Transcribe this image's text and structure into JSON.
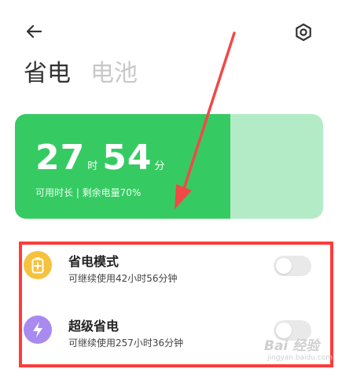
{
  "header": {
    "tabs": [
      {
        "label": "省电",
        "active": true
      },
      {
        "label": "电池",
        "active": false
      }
    ]
  },
  "battery_card": {
    "hours": "27",
    "hours_unit": "时",
    "minutes": "54",
    "minutes_unit": "分",
    "subtitle": "可用时长 | 剩余电量70%",
    "level_percent": 70,
    "fill_color": "#36cb62",
    "empty_color": "#b4ebc7"
  },
  "modes": [
    {
      "title": "省电模式",
      "description": "可继续使用42小时56分钟",
      "icon": "battery-plus-icon",
      "icon_color": "#f6c23e",
      "enabled": false
    },
    {
      "title": "超级省电",
      "description": "可继续使用257小时36分钟",
      "icon": "lightning-icon",
      "icon_color": "#a98af0",
      "enabled": false
    }
  ],
  "annotation_color": "#ff3b3b",
  "watermark": {
    "logo": "Bai 经验",
    "url": "jingyan.baidu.com"
  }
}
